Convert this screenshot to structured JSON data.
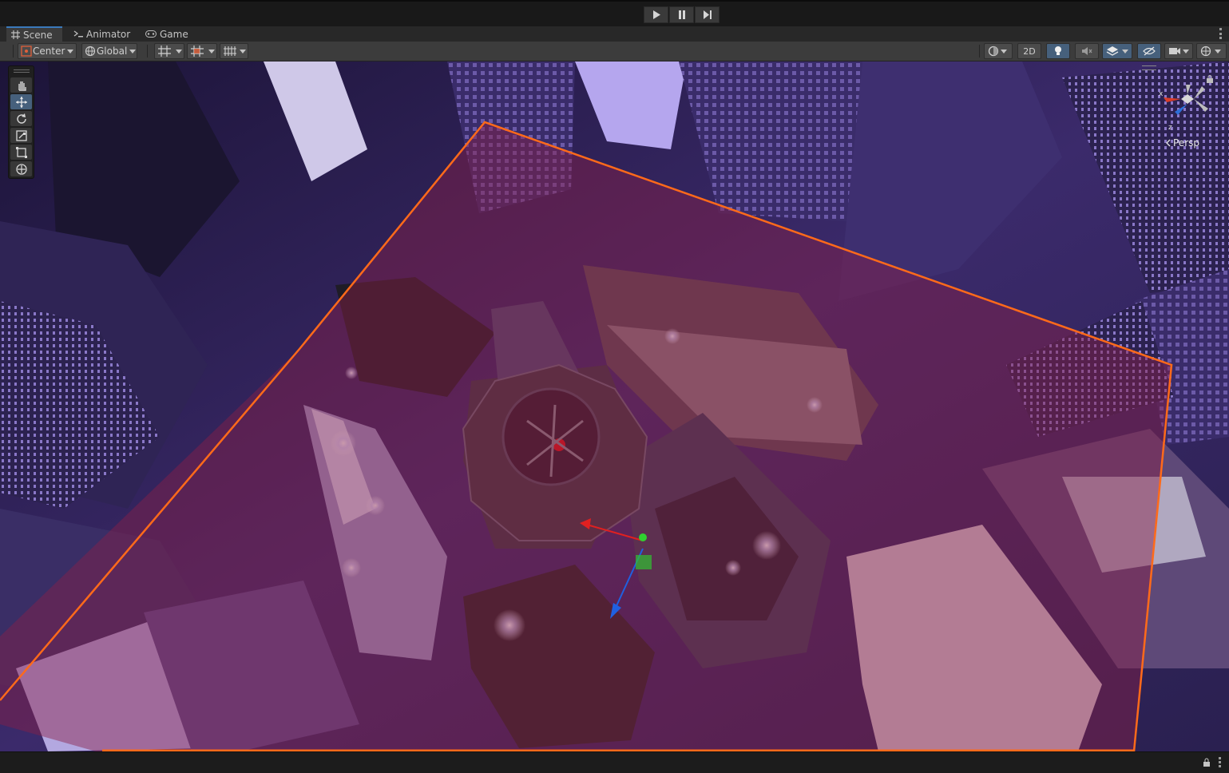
{
  "playbar": {
    "play_icon": "play-icon",
    "pause_icon": "pause-icon",
    "step_icon": "step-icon"
  },
  "tabs": [
    {
      "label": "Scene",
      "icon": "hash-grid-icon"
    },
    {
      "label": "Animator",
      "icon": "animator-icon"
    },
    {
      "label": "Game",
      "icon": "gamepad-icon"
    }
  ],
  "toolbar": {
    "pivot_label": "Center",
    "space_label": "Global",
    "toggle_2d_label": "2D"
  },
  "scene": {
    "projection_label": "Persp",
    "axis_x_label": "x",
    "axis_z_label": "z",
    "selection_color": "#ff6a1a",
    "overlay_tint": "#7a1f3c"
  }
}
